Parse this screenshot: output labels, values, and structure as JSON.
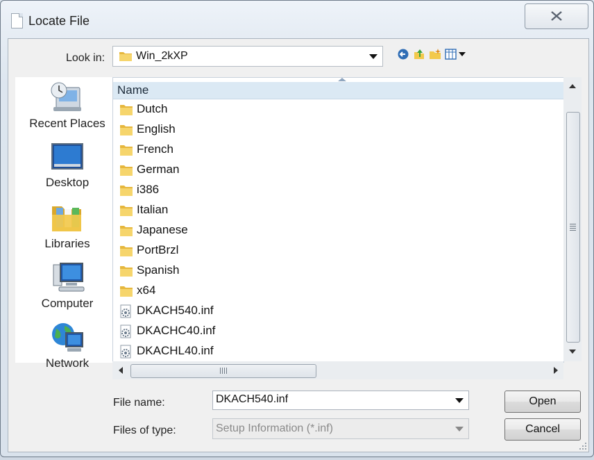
{
  "window": {
    "title": "Locate File"
  },
  "lookin": {
    "label": "Look in:",
    "value": "Win_2kXP"
  },
  "places": [
    {
      "label": "Recent Places",
      "icon": "recent-places-icon"
    },
    {
      "label": "Desktop",
      "icon": "desktop-icon"
    },
    {
      "label": "Libraries",
      "icon": "libraries-icon"
    },
    {
      "label": "Computer",
      "icon": "computer-icon"
    },
    {
      "label": "Network",
      "icon": "network-icon"
    }
  ],
  "filelist": {
    "column_header": "Name",
    "items": [
      {
        "name": "Dutch",
        "type": "folder"
      },
      {
        "name": "English",
        "type": "folder"
      },
      {
        "name": "French",
        "type": "folder"
      },
      {
        "name": "German",
        "type": "folder"
      },
      {
        "name": "i386",
        "type": "folder"
      },
      {
        "name": "Italian",
        "type": "folder"
      },
      {
        "name": "Japanese",
        "type": "folder"
      },
      {
        "name": "PortBrzl",
        "type": "folder"
      },
      {
        "name": "Spanish",
        "type": "folder"
      },
      {
        "name": "x64",
        "type": "folder"
      },
      {
        "name": "DKACH540.inf",
        "type": "inf"
      },
      {
        "name": "DKACHC40.inf",
        "type": "inf"
      },
      {
        "name": "DKACHL40.inf",
        "type": "inf"
      }
    ]
  },
  "form": {
    "filename_label": "File name:",
    "filename_value": "DKACH540.inf",
    "filetype_label": "Files of type:",
    "filetype_value": "Setup Information (*.inf)"
  },
  "buttons": {
    "open": "Open",
    "cancel": "Cancel"
  },
  "colors": {
    "header_bg": "#dbe9f4",
    "folder": "#f2c94c",
    "accent": "#2f6db5"
  }
}
